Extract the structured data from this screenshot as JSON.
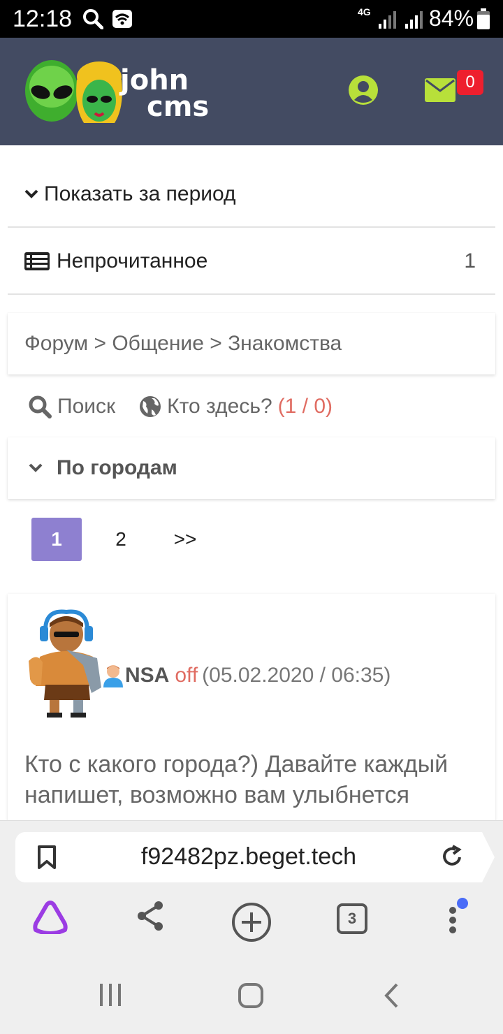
{
  "status_bar": {
    "time": "12:18",
    "network": "4G",
    "battery": "84%"
  },
  "header": {
    "logo_line1": "john",
    "logo_line2": "cms",
    "mail_count": "0"
  },
  "menu": {
    "period_label": "Показать за период",
    "unread_label": "Непрочитанное",
    "unread_count": "1"
  },
  "breadcrumb": "Форум > Общение > Знакомства",
  "tools": {
    "search_label": "Поиск",
    "who_here_label": "Кто здесь?",
    "who_here_count": "(1 / 0)"
  },
  "topic_title": "По городам",
  "pagination": {
    "pages": [
      "1",
      "2"
    ],
    "active": "1",
    "next_label": ">>"
  },
  "post": {
    "nick": "NSA",
    "status": "off",
    "date": "(05.02.2020 / 06:35)",
    "text": "Кто с какого города?) Давайте каждый напишет, возможно вам улыбнется"
  },
  "browser": {
    "url": "f92482pz.beget.tech",
    "tabs_count": "3"
  },
  "colors": {
    "header_bg": "#434b62",
    "accent_green": "#b8e03a",
    "pager_active": "#8e80d0",
    "status_red": "#e06c62",
    "badge_red": "#ee1f2e"
  }
}
